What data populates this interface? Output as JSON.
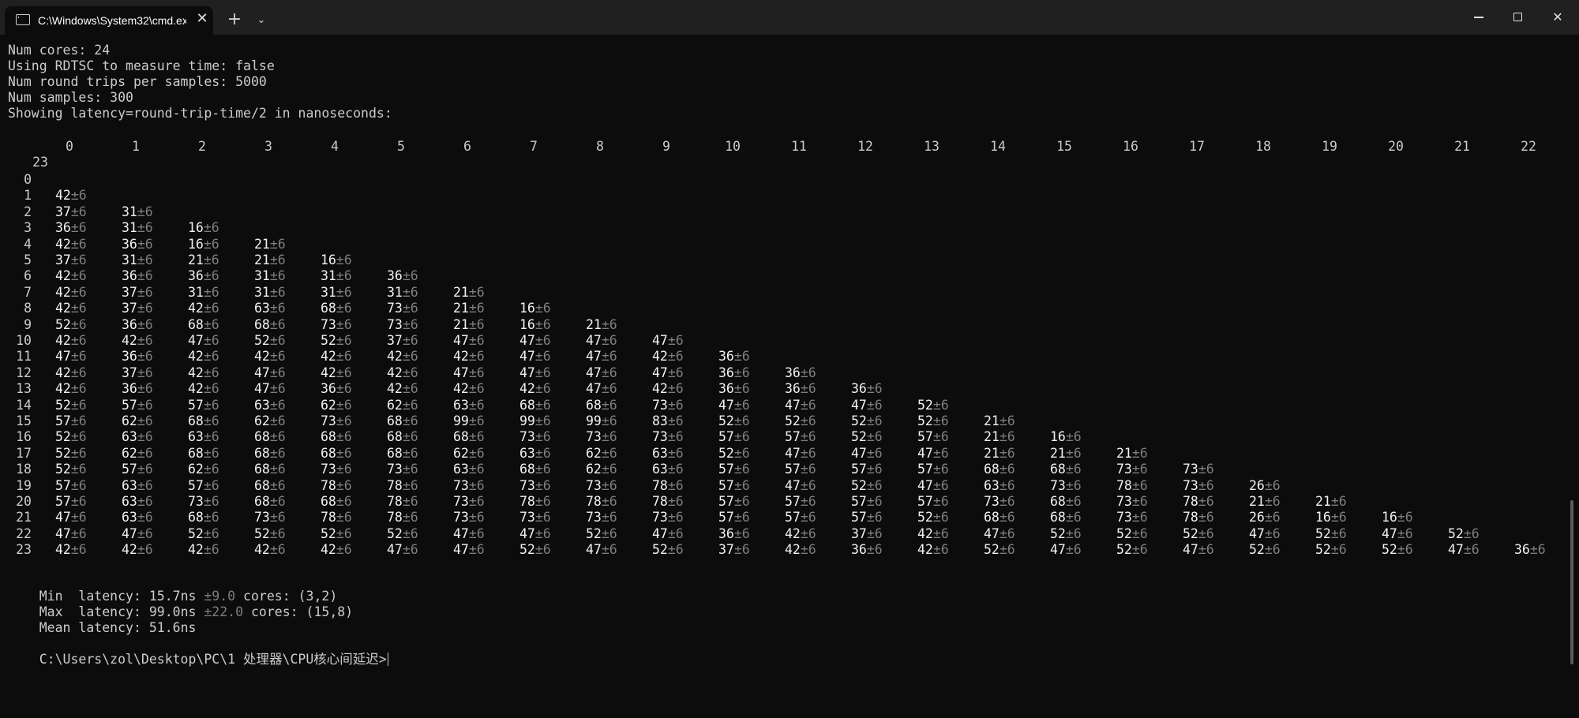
{
  "window": {
    "tab_title": "C:\\Windows\\System32\\cmd.exe",
    "close_tab_glyph": "✕",
    "new_tab_glyph": "+",
    "dropdown_glyph": "⌄",
    "close_glyph": "✕",
    "icons": {
      "tab": "terminal-icon",
      "minimize": "minimize-icon",
      "maximize": "maximize-icon",
      "close": "close-icon"
    }
  },
  "terminal": {
    "info_lines": [
      "Num cores: 24",
      "Using RDTSC to measure time: false",
      "Num round trips per samples: 5000",
      "Num samples: 300",
      "Showing latency=round-trip-time/2 in nanoseconds:"
    ],
    "column_headers": [
      "0",
      "1",
      "2",
      "3",
      "4",
      "5",
      "6",
      "7",
      "8",
      "9",
      "10",
      "11",
      "12",
      "13",
      "14",
      "15",
      "16",
      "17",
      "18",
      "19",
      "20",
      "21",
      "22",
      "23"
    ],
    "row_labels": [
      "0",
      "1",
      "2",
      "3",
      "4",
      "5",
      "6",
      "7",
      "8",
      "9",
      "10",
      "11",
      "12",
      "13",
      "14",
      "15",
      "16",
      "17",
      "18",
      "19",
      "20",
      "21",
      "22",
      "23"
    ],
    "error_suffix": "±6",
    "matrix": [
      [],
      [
        42
      ],
      [
        37,
        31
      ],
      [
        36,
        31,
        16
      ],
      [
        42,
        36,
        16,
        21
      ],
      [
        37,
        31,
        21,
        21,
        16
      ],
      [
        42,
        36,
        36,
        31,
        31,
        36
      ],
      [
        42,
        37,
        31,
        31,
        31,
        31,
        21
      ],
      [
        42,
        37,
        42,
        63,
        68,
        73,
        21,
        16
      ],
      [
        52,
        36,
        68,
        68,
        73,
        73,
        21,
        16,
        21
      ],
      [
        42,
        42,
        47,
        52,
        52,
        37,
        47,
        47,
        47,
        47
      ],
      [
        47,
        36,
        42,
        42,
        42,
        42,
        42,
        47,
        47,
        42,
        36
      ],
      [
        42,
        37,
        42,
        47,
        42,
        42,
        47,
        47,
        47,
        47,
        36,
        36
      ],
      [
        42,
        36,
        42,
        47,
        36,
        42,
        42,
        42,
        47,
        42,
        36,
        36,
        36
      ],
      [
        52,
        57,
        57,
        63,
        62,
        62,
        63,
        68,
        68,
        73,
        47,
        47,
        47,
        52
      ],
      [
        57,
        62,
        68,
        62,
        73,
        68,
        99,
        99,
        99,
        83,
        52,
        52,
        52,
        52,
        21
      ],
      [
        52,
        63,
        63,
        68,
        68,
        68,
        68,
        73,
        73,
        73,
        57,
        57,
        52,
        57,
        21,
        16
      ],
      [
        52,
        62,
        68,
        68,
        68,
        68,
        62,
        63,
        62,
        63,
        52,
        47,
        47,
        47,
        21,
        21,
        21
      ],
      [
        52,
        57,
        62,
        68,
        73,
        73,
        63,
        68,
        62,
        63,
        57,
        57,
        57,
        57,
        68,
        68,
        73,
        73
      ],
      [
        57,
        63,
        57,
        68,
        78,
        78,
        73,
        73,
        73,
        78,
        57,
        47,
        52,
        47,
        63,
        73,
        78,
        73,
        26
      ],
      [
        57,
        63,
        73,
        68,
        68,
        78,
        73,
        78,
        78,
        78,
        57,
        57,
        57,
        57,
        73,
        68,
        73,
        78,
        21,
        21
      ],
      [
        47,
        63,
        68,
        73,
        78,
        78,
        73,
        73,
        73,
        73,
        57,
        57,
        57,
        52,
        68,
        68,
        73,
        78,
        26,
        16,
        16
      ],
      [
        47,
        47,
        52,
        52,
        52,
        52,
        47,
        47,
        52,
        47,
        36,
        42,
        37,
        42,
        47,
        52,
        52,
        52,
        47,
        52,
        47,
        52
      ],
      [
        42,
        42,
        42,
        42,
        42,
        47,
        47,
        52,
        47,
        52,
        37,
        42,
        36,
        42,
        52,
        47,
        52,
        47,
        52,
        52,
        52,
        47,
        36
      ]
    ],
    "summary": [
      {
        "label": "Min  latency: ",
        "value": "15.7ns",
        "err": "±9.0",
        "cores": " cores: (3,2)"
      },
      {
        "label": "Max  latency: ",
        "value": "99.0ns",
        "err": "±22.0",
        "cores": " cores: (15,8)"
      },
      {
        "label": "Mean latency: ",
        "value": "51.6ns",
        "err": "",
        "cores": ""
      }
    ],
    "prompt": "C:\\Users\\zol\\Desktop\\PC\\1 处理器\\CPU核心间延迟>"
  }
}
